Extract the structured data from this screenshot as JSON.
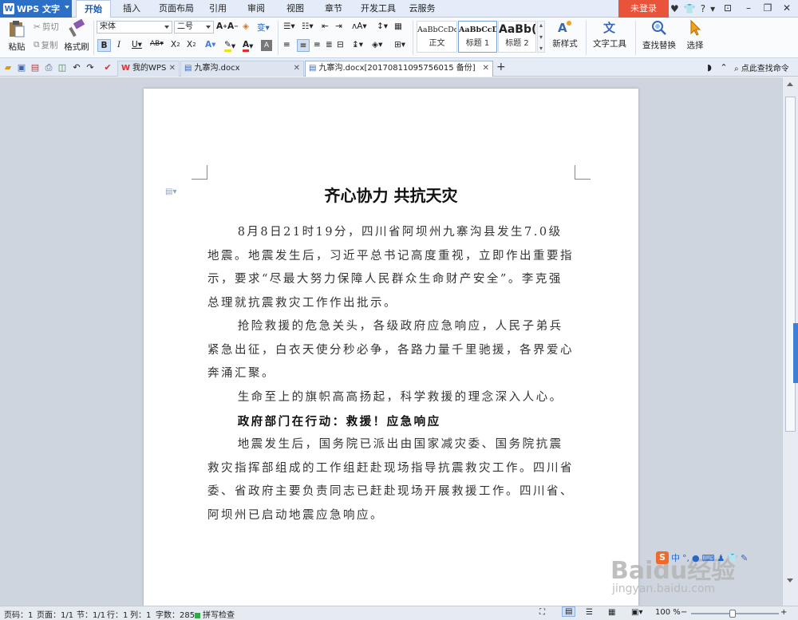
{
  "menubar": {
    "app_name": "WPS 文字",
    "tabs": [
      "开始",
      "插入",
      "页面布局",
      "引用",
      "审阅",
      "视图",
      "章节",
      "开发工具",
      "云服务"
    ],
    "active_tab": "开始",
    "login_label": "未登录",
    "help_label": "?"
  },
  "ribbon": {
    "paste_label": "粘贴",
    "cut_label": "剪切",
    "copy_label": "复制",
    "format_painter_label": "格式刷",
    "font_name": "宋体",
    "font_size": "二号",
    "styles": [
      {
        "sample": "AaBbCcDd",
        "name": "正文"
      },
      {
        "sample": "AaBbCcDd",
        "name": "标题 1"
      },
      {
        "sample": "AaBb(",
        "name": "标题 2"
      }
    ],
    "new_style_label": "新样式",
    "text_tools_label": "文字工具",
    "find_replace_label": "查找替换",
    "select_label": "选择"
  },
  "tabbar": {
    "tabs": [
      {
        "label": "我的WPS",
        "active": false
      },
      {
        "label": "九寨沟.docx",
        "active": false
      },
      {
        "label": "九寨沟.docx[20170811095756015 备份]",
        "active": true
      }
    ],
    "find_command_label": "点此查找命令"
  },
  "document": {
    "title": "齐心协力 共抗天灾",
    "paragraphs": [
      "8月8日21时19分，四川省阿坝州九寨沟县发生7.0级地震。地震发生后，习近平总书记高度重视，立即作出重要指示，要求“尽最大努力保障人民群众生命财产安全”。李克强总理就抗震救灾工作作出批示。",
      "抢险救援的危急关头，各级政府应急响应，人民子弟兵紧急出征，白衣天使分秒必争，各路力量千里驰援，各界爱心奔涌汇聚。",
      "生命至上的旗帜高高扬起，科学救援的理念深入人心。",
      "政府部门在行动：救援！应急响应",
      "地震发生后，国务院已派出由国家减灾委、国务院抗震救灾指挥部组成的工作组赶赴现场指导抗震救灾工作。四川省委、省政府主要负责同志已赶赴现场开展救援工作。四川省、阿坝州已启动地震应急响应。"
    ]
  },
  "ime": {
    "mode": "中"
  },
  "watermark": {
    "brand": "Baidu经验",
    "url": "jingyan.baidu.com"
  },
  "statusbar": {
    "page_number": "页码：1",
    "page_count": "页面：1/1",
    "section": "节：1/1",
    "row": "行：1",
    "column": "列：1",
    "word_count": "字数：285",
    "spell_check": "拼写检查",
    "zoom": "100 %",
    "zoom_fraction": 0.47
  }
}
